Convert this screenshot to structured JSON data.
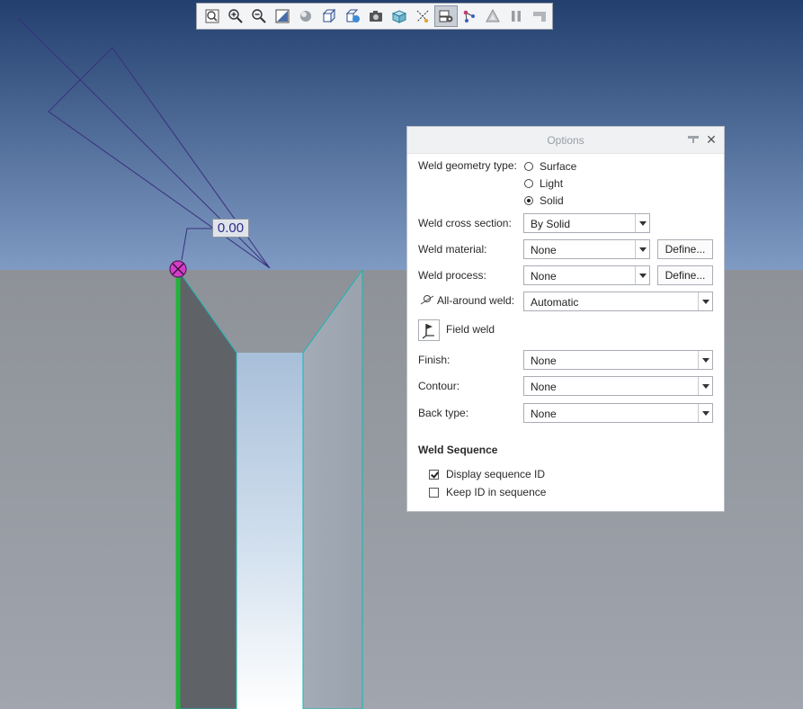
{
  "viewport": {
    "dimension_value": "0.00"
  },
  "toolbar": {
    "buttons": [
      {
        "icon": "refit-icon"
      },
      {
        "icon": "zoom-in-icon"
      },
      {
        "icon": "zoom-out-icon"
      },
      {
        "icon": "repaint-icon"
      },
      {
        "icon": "display-style-icon"
      },
      {
        "icon": "saved-orientations-icon"
      },
      {
        "icon": "view-manager-icon"
      },
      {
        "icon": "perspective-view-icon"
      },
      {
        "icon": "section-icon"
      },
      {
        "icon": "datum-display-icon"
      },
      {
        "icon": "annotation-display-icon"
      },
      {
        "icon": "spin-center-icon"
      },
      {
        "icon": "triangle-icon"
      },
      {
        "icon": "pause-icon"
      },
      {
        "icon": "flat-icon"
      }
    ]
  },
  "options": {
    "title": "Options",
    "geometry_type_label": "Weld geometry type:",
    "geometry_types": [
      {
        "label": "Surface",
        "selected": false
      },
      {
        "label": "Light",
        "selected": false
      },
      {
        "label": "Solid",
        "selected": true
      }
    ],
    "cross_section_label": "Weld cross section:",
    "cross_section_value": "By Solid",
    "material_label": "Weld material:",
    "material_value": "None",
    "material_define": "Define...",
    "process_label": "Weld process:",
    "process_value": "None",
    "process_define": "Define...",
    "all_around_label": "All-around weld:",
    "all_around_value": "Automatic",
    "field_weld_label": "Field weld",
    "finish_label": "Finish:",
    "finish_value": "None",
    "contour_label": "Contour:",
    "contour_value": "None",
    "back_type_label": "Back type:",
    "back_type_value": "None",
    "sequence_heading": "Weld Sequence",
    "display_sequence_label": "Display sequence ID",
    "display_sequence_checked": true,
    "keep_id_label": "Keep ID in sequence",
    "keep_id_checked": false
  },
  "colors": {
    "sky_top": "#23406f",
    "sky_bottom": "#7e9ac2",
    "floor": "#969ba3",
    "weld_green": "#22b33a",
    "weld_marker": "#d23ec8",
    "plate_edge": "#18b6b6"
  }
}
